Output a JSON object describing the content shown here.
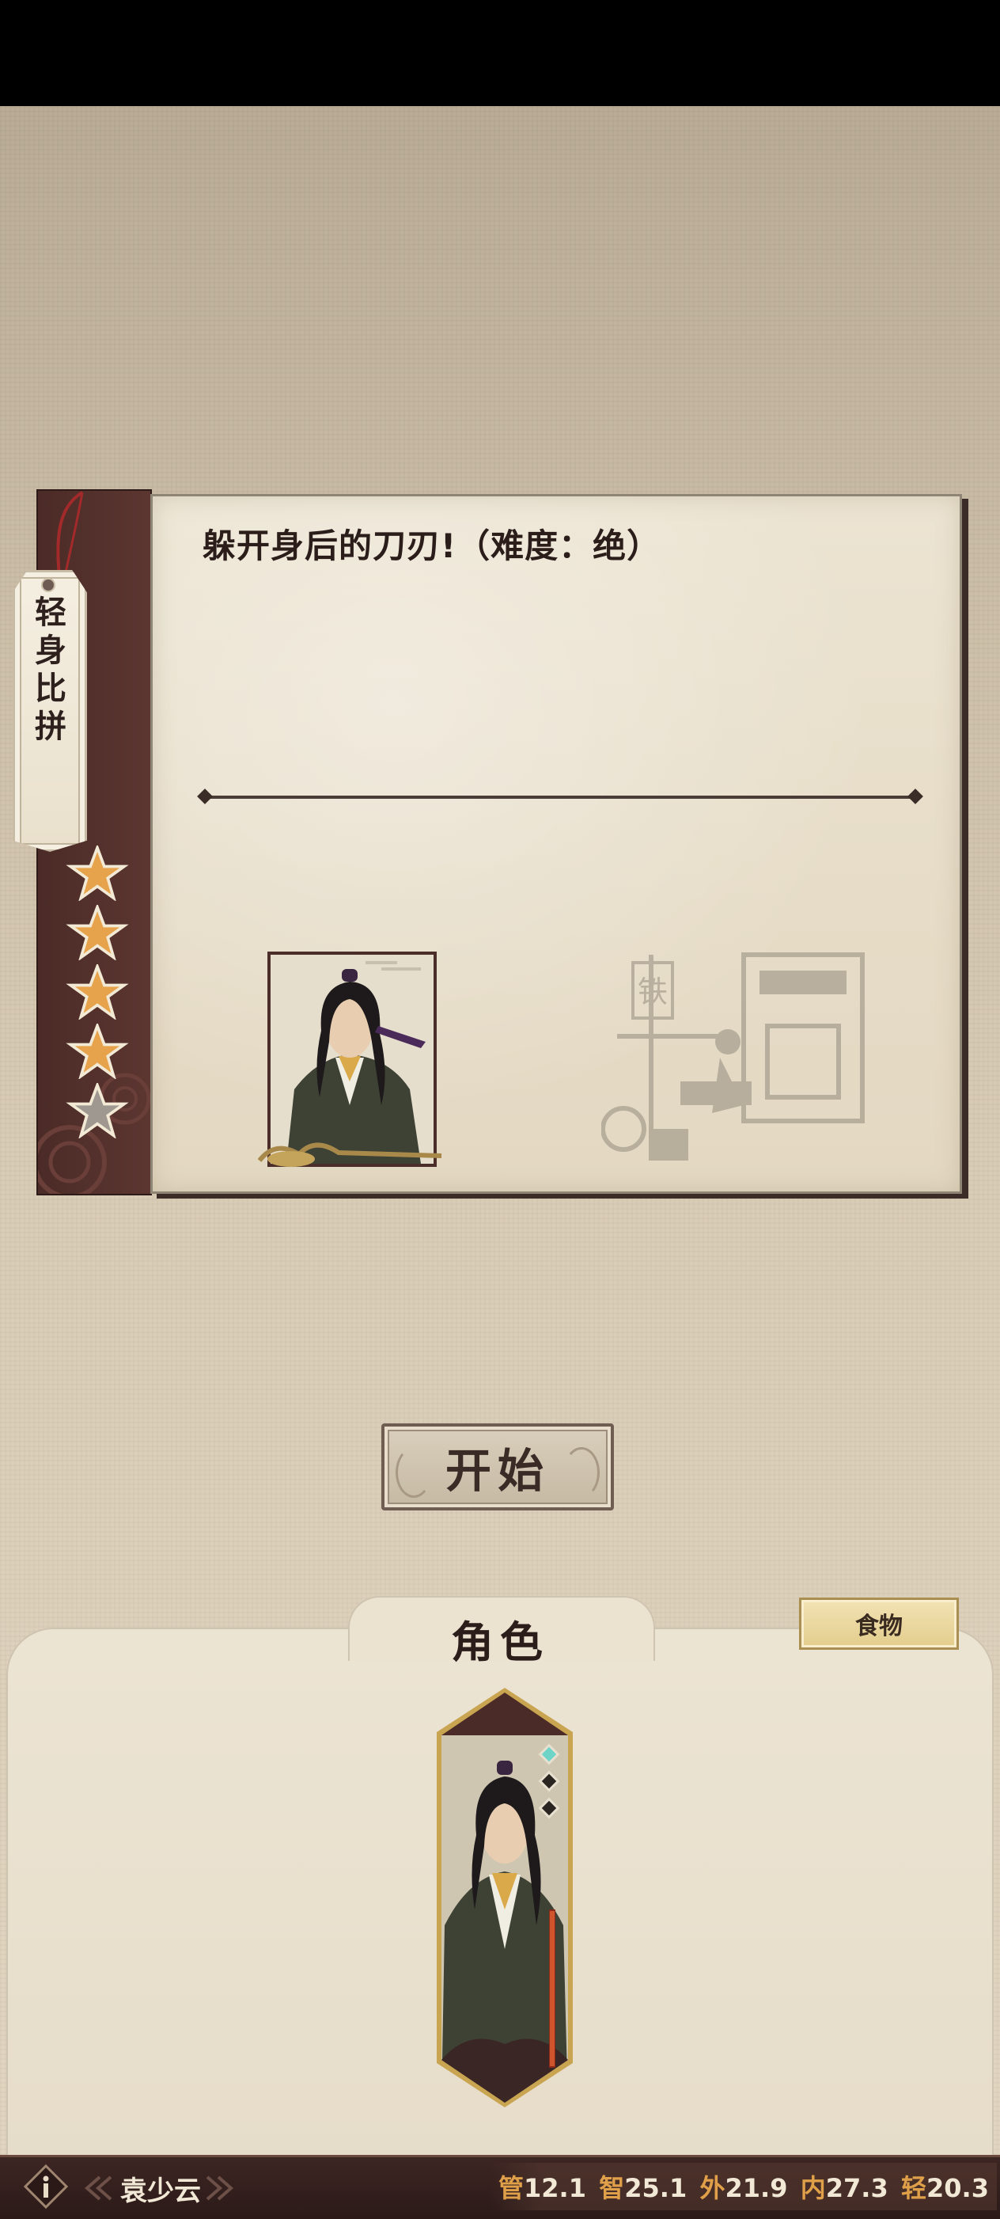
{
  "challenge": {
    "category": "轻身比拼",
    "title": "躲开身后的刀刃!（难度：绝）",
    "difficulty_stars_filled": 4,
    "difficulty_stars_total": 5,
    "sign_text": "铁"
  },
  "start_button": {
    "label": "开始"
  },
  "roster": {
    "title": "角色",
    "food_button": "食物",
    "selected_character": {
      "gems": [
        "filled",
        "empty",
        "empty"
      ]
    }
  },
  "status_bar": {
    "character_name": "袁少云",
    "stats": [
      {
        "key": "管",
        "value": "12.1"
      },
      {
        "key": "智",
        "value": "25.1"
      },
      {
        "key": "外",
        "value": "21.9"
      },
      {
        "key": "内",
        "value": "27.3"
      },
      {
        "key": "轻",
        "value": "20.3"
      }
    ]
  },
  "colors": {
    "accent_gold": "#e0a04a",
    "spine": "#4b2b27",
    "star_filled": "#e7a24c",
    "star_empty": "#9e9890"
  }
}
